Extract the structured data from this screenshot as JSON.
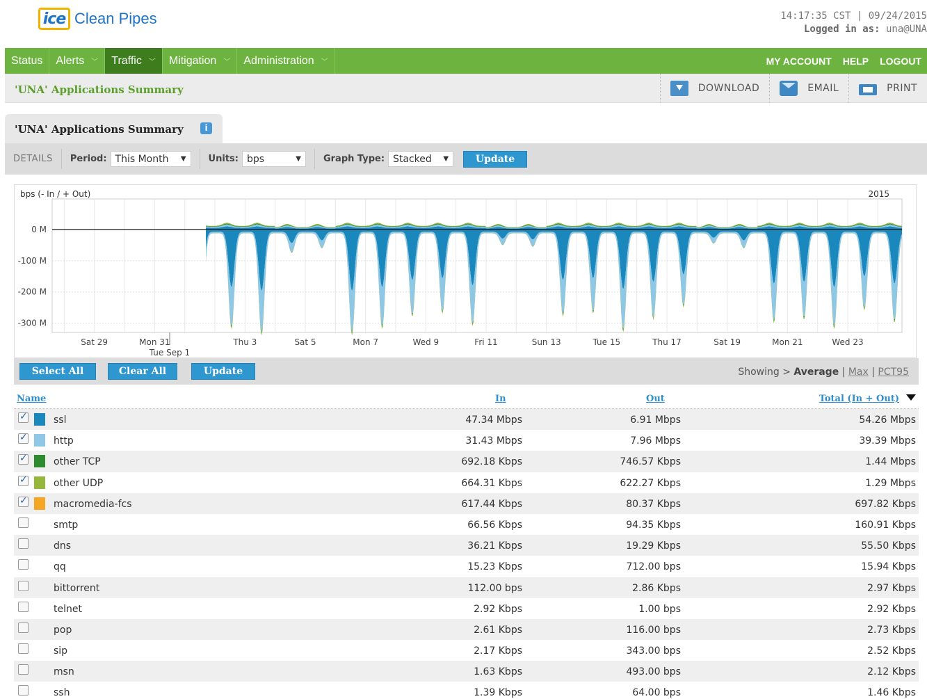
{
  "header": {
    "logo_mark": "ice",
    "logo_text": "Clean Pipes",
    "datetime": "14:17:35 CST | 09/24/2015",
    "login_label": "Logged in as:",
    "login_user": "una@UNA"
  },
  "nav": {
    "items": [
      {
        "label": "Status",
        "chevron": false,
        "active": false
      },
      {
        "label": "Alerts",
        "chevron": true,
        "active": false
      },
      {
        "label": "Traffic",
        "chevron": true,
        "active": true
      },
      {
        "label": "Mitigation",
        "chevron": true,
        "active": false
      },
      {
        "label": "Administration",
        "chevron": true,
        "active": false
      }
    ],
    "right_links": [
      "MY ACCOUNT",
      "HELP",
      "LOGOUT"
    ]
  },
  "subbar": {
    "title": "'UNA' Applications Summary",
    "actions": [
      {
        "label": "DOWNLOAD",
        "icon": "download-icon"
      },
      {
        "label": "EMAIL",
        "icon": "email-icon"
      },
      {
        "label": "PRINT",
        "icon": "print-icon"
      }
    ]
  },
  "tab": {
    "title": "'UNA' Applications Summary",
    "info": "i"
  },
  "controls": {
    "details": "DETAILS",
    "period_label": "Period:",
    "period_value": "This Month",
    "units_label": "Units:",
    "units_value": "bps",
    "graph_type_label": "Graph Type:",
    "graph_type_value": "Stacked",
    "update_label": "Update"
  },
  "chart_data": {
    "type": "area",
    "stacked": true,
    "ylabel": "bps (- In / + Out)",
    "year_label": "2015",
    "y_ticks": [
      "0 M",
      "-100 M",
      "-200 M",
      "-300 M"
    ],
    "y_tick_values": [
      0,
      -100,
      -200,
      -300
    ],
    "ylim": [
      -330,
      85
    ],
    "x_ticks": [
      "Sat 29",
      "Mon 31",
      "Tue Sep 1",
      "Thu 3",
      "Sat 5",
      "Mon 7",
      "Wed 9",
      "Fri 11",
      "Sun 13",
      "Tue 15",
      "Thu 17",
      "Sat 19",
      "Mon 21",
      "Wed 23"
    ],
    "x_tick_days": [
      -2,
      0,
      0.5,
      3,
      5,
      7,
      9,
      11,
      13,
      15,
      17,
      19,
      21,
      23
    ],
    "x_range_days": [
      -3.4,
      24.8
    ],
    "data_start_day": 1.7,
    "data_end_day": 24.8,
    "weekday_in_peak_mbps": [
      -300,
      -320,
      -340,
      -340,
      -320,
      -280,
      -270,
      -310,
      -280,
      -270,
      -330,
      -290,
      -250,
      -300,
      -290,
      -320,
      -260
    ],
    "weekend_in_peak_mbps": [
      -75,
      -60,
      -50,
      -55,
      -45,
      -60
    ],
    "series": [
      {
        "name": "ssl",
        "color": "#1a88bd",
        "in_fraction": 0.58,
        "out_fraction": 0.47
      },
      {
        "name": "http",
        "color": "#8fc7e6",
        "in_fraction": 0.39,
        "out_fraction": 0.27
      },
      {
        "name": "other TCP",
        "color": "#2e8b2e",
        "in_fraction": 0.012,
        "out_fraction": 0.13
      },
      {
        "name": "other UDP",
        "color": "#95b83a",
        "in_fraction": 0.018,
        "out_fraction": 0.13
      }
    ]
  },
  "buttons": {
    "select_all": "Select All",
    "clear_all": "Clear All",
    "update": "Update"
  },
  "showing": {
    "prefix": "Showing >",
    "current": "Average",
    "sep": "|",
    "max": "Max",
    "pct95": "PCT95"
  },
  "table": {
    "headers": {
      "name": "Name",
      "in": "In",
      "out": "Out",
      "total": "Total (In + Out)"
    },
    "rows": [
      {
        "name": "ssl",
        "checked": true,
        "color": "#1a88bd",
        "in": "47.34 Mbps",
        "out": "6.91 Mbps",
        "total": "54.26 Mbps"
      },
      {
        "name": "http",
        "checked": true,
        "color": "#8fc7e6",
        "in": "31.43 Mbps",
        "out": "7.96 Mbps",
        "total": "39.39 Mbps"
      },
      {
        "name": "other TCP",
        "checked": true,
        "color": "#2e8b2e",
        "in": "692.18 Kbps",
        "out": "746.57 Kbps",
        "total": "1.44 Mbps"
      },
      {
        "name": "other UDP",
        "checked": true,
        "color": "#95b83a",
        "in": "664.31 Kbps",
        "out": "622.27 Kbps",
        "total": "1.29 Mbps"
      },
      {
        "name": "macromedia-fcs",
        "checked": true,
        "color": "#f5a623",
        "in": "617.44 Kbps",
        "out": "80.37 Kbps",
        "total": "697.82 Kbps"
      },
      {
        "name": "smtp",
        "checked": false,
        "color": "",
        "in": "66.56 Kbps",
        "out": "94.35 Kbps",
        "total": "160.91 Kbps"
      },
      {
        "name": "dns",
        "checked": false,
        "color": "",
        "in": "36.21 Kbps",
        "out": "19.29 Kbps",
        "total": "55.50 Kbps"
      },
      {
        "name": "qq",
        "checked": false,
        "color": "",
        "in": "15.23 Kbps",
        "out": "712.00 bps",
        "total": "15.94 Kbps"
      },
      {
        "name": "bittorrent",
        "checked": false,
        "color": "",
        "in": "112.00 bps",
        "out": "2.86 Kbps",
        "total": "2.97 Kbps"
      },
      {
        "name": "telnet",
        "checked": false,
        "color": "",
        "in": "2.92 Kbps",
        "out": "1.00 bps",
        "total": "2.92 Kbps"
      },
      {
        "name": "pop",
        "checked": false,
        "color": "",
        "in": "2.61 Kbps",
        "out": "116.00 bps",
        "total": "2.73 Kbps"
      },
      {
        "name": "sip",
        "checked": false,
        "color": "",
        "in": "2.17 Kbps",
        "out": "343.00 bps",
        "total": "2.52 Kbps"
      },
      {
        "name": "msn",
        "checked": false,
        "color": "",
        "in": "1.63 Kbps",
        "out": "493.00 bps",
        "total": "2.12 Kbps"
      },
      {
        "name": "ssh",
        "checked": false,
        "color": "",
        "in": "1.39 Kbps",
        "out": "64.00 bps",
        "total": "1.46 Kbps"
      }
    ]
  }
}
